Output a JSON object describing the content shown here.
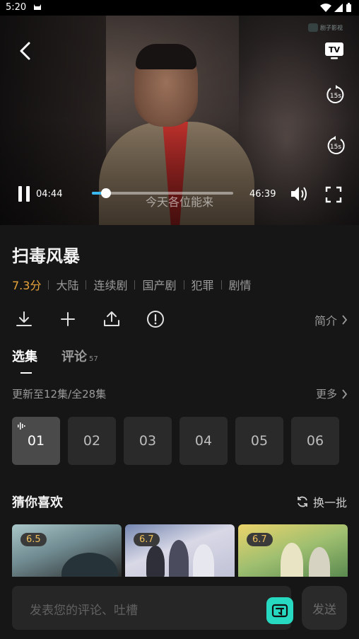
{
  "status_bar": {
    "time": "5:20"
  },
  "video": {
    "subtitle": "今天各位能来",
    "current_time": "04:44",
    "total_time": "46:39",
    "progress": 0.1,
    "rewind_seconds": "15s",
    "forward_seconds": "15s",
    "tv_label": "TV",
    "watermark": "剧子影视"
  },
  "show": {
    "title": "扫毒风暴",
    "rating": "7.3分",
    "tags": [
      "大陆",
      "连续剧",
      "国产剧",
      "犯罪",
      "剧情"
    ],
    "intro_label": "简介"
  },
  "tabs": [
    {
      "label": "选集",
      "count": ""
    },
    {
      "label": "评论",
      "count": "57"
    }
  ],
  "episodes": {
    "update_text": "更新至12集/全28集",
    "more_label": "更多",
    "items": [
      "01",
      "02",
      "03",
      "04",
      "05",
      "06"
    ],
    "active_index": 0
  },
  "recommend": {
    "title": "猜你喜欢",
    "refresh_label": "换一批",
    "items": [
      {
        "score": "6.5"
      },
      {
        "score": "6.7"
      },
      {
        "score": "6.7"
      }
    ]
  },
  "comment": {
    "placeholder": "发表您的评论、吐槽",
    "send_label": "发送"
  },
  "colors": {
    "accent_rating": "#e9a53b",
    "progress": "#3ab8f0",
    "fab": "#26d9c0"
  }
}
